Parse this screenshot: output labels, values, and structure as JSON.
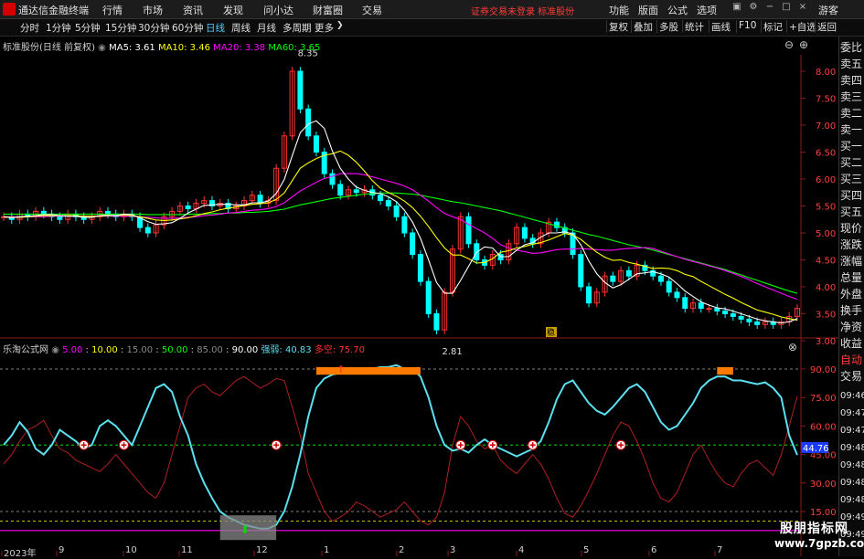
{
  "app": {
    "title": "通达信金融终端",
    "menus": [
      "行情",
      "市场",
      "资讯",
      "发现",
      "问小达",
      "财富圈",
      "交易"
    ],
    "login_warning": "证券交易未登录",
    "stock_name": "标准股份",
    "right_menus": [
      "功能",
      "版面",
      "公式",
      "选项"
    ],
    "guest": "游客"
  },
  "toolbar": {
    "periods": [
      "分时",
      "1分钟",
      "5分钟",
      "15分钟",
      "30分钟",
      "60分钟",
      "日线",
      "周线",
      "月线",
      "多周期",
      "更多"
    ],
    "active_period": "日线",
    "right_buttons": [
      "复权",
      "叠加",
      "多股",
      "统计",
      "画线",
      "F10",
      "标记",
      "+自选",
      "返回"
    ]
  },
  "kline_legend": {
    "name": "标准股份(日线 前复权)",
    "ma5": "MA5: 3.61",
    "ma10": "MA10: 3.46",
    "ma20": "MA20: 3.38",
    "ma60": "MA60: 3.65"
  },
  "price_axis": [
    "8.00",
    "7.50",
    "7.00",
    "6.50",
    "6.00",
    "5.50",
    "5.00",
    "4.50",
    "4.00",
    "3.50",
    "3.00"
  ],
  "price_annotations": {
    "high": "8.35",
    "low": "2.81",
    "marker": "稳"
  },
  "ind_legend": {
    "name": "乐淘公式网",
    "v1": "5.00",
    "v2": "10.00",
    "v3": "15.00",
    "v4": "50.00",
    "v5": "85.00",
    "v6": "90.00",
    "strong_label": "强弱:",
    "strong_val": "40.83",
    "dk_label": "多空:",
    "dk_val": "75.70"
  },
  "ind_axis": [
    "90.00",
    "75.00",
    "60.00",
    "45.00",
    "30.00",
    "15.00"
  ],
  "ind_current": "44.76",
  "x_axis": [
    "2023年",
    "9",
    "10",
    "11",
    "12",
    "1",
    "2",
    "3",
    "4",
    "5",
    "6",
    "7"
  ],
  "sidebar": {
    "items": [
      "委比",
      "卖五",
      "卖四",
      "卖三",
      "卖二",
      "卖一",
      "买一",
      "买二",
      "买三",
      "买四",
      "买五",
      "现价",
      "涨跌",
      "涨幅",
      "总量",
      "外盘",
      "换手",
      "净资",
      "收益",
      "自动",
      "交易"
    ],
    "times": [
      "09:46",
      "09:47",
      "09:47",
      "09:48",
      "09:48",
      "09:48",
      "09:48",
      "09:49",
      "09:49"
    ]
  },
  "watermark": {
    "line1": "股朋指标网",
    "line2": "www.7gpzb.com"
  },
  "colors": {
    "up": "#ff3232",
    "down": "#00ffff",
    "ma5": "#ffffff",
    "ma10": "#ffff00",
    "ma20": "#ff00ff",
    "ma60": "#00ff00",
    "strong": "#5ae0f0",
    "dk": "#b02020",
    "signal": "#ff7a00"
  },
  "series": {
    "close": [
      5.3,
      5.25,
      5.35,
      5.3,
      5.4,
      5.35,
      5.3,
      5.25,
      5.35,
      5.3,
      5.25,
      5.3,
      5.4,
      5.35,
      5.3,
      5.35,
      5.3,
      5.1,
      5.0,
      5.15,
      5.3,
      5.4,
      5.5,
      5.45,
      5.55,
      5.6,
      5.5,
      5.55,
      5.45,
      5.5,
      5.6,
      5.7,
      5.55,
      5.6,
      6.2,
      6.8,
      8.0,
      7.3,
      6.8,
      6.5,
      6.1,
      5.9,
      5.7,
      5.8,
      5.75,
      5.8,
      5.7,
      5.6,
      5.5,
      5.3,
      5.0,
      4.6,
      4.1,
      3.5,
      3.2,
      3.9,
      4.7,
      5.3,
      4.8,
      4.5,
      4.4,
      4.6,
      4.5,
      4.8,
      5.1,
      4.9,
      4.8,
      5.0,
      5.2,
      5.1,
      5.0,
      4.6,
      4.0,
      3.7,
      3.9,
      4.2,
      4.1,
      4.3,
      4.2,
      4.4,
      4.3,
      4.2,
      4.1,
      3.9,
      3.8,
      3.6,
      3.7,
      3.6,
      3.6,
      3.55,
      3.5,
      3.45,
      3.4,
      3.35,
      3.3,
      3.35,
      3.3,
      3.35,
      3.45,
      3.6
    ],
    "ma5": [
      5.3,
      5.28,
      5.3,
      5.31,
      5.32,
      5.34,
      5.34,
      5.32,
      5.31,
      5.31,
      5.29,
      5.29,
      5.32,
      5.33,
      5.32,
      5.35,
      5.34,
      5.28,
      5.21,
      5.16,
      5.17,
      5.19,
      5.27,
      5.37,
      5.44,
      5.51,
      5.52,
      5.53,
      5.53,
      5.52,
      5.52,
      5.56,
      5.56,
      5.59,
      5.73,
      5.99,
      6.43,
      6.86,
      7.02,
      7.08,
      6.94,
      6.52,
      6.2,
      6.0,
      5.85,
      5.79,
      5.75,
      5.73,
      5.67,
      5.58,
      5.42,
      5.2,
      4.9,
      4.5,
      4.08,
      3.88,
      3.88,
      4.12,
      4.38,
      4.64,
      4.74,
      4.72,
      4.56,
      4.56,
      4.68,
      4.78,
      4.82,
      4.92,
      5.0,
      5.0,
      5.02,
      4.98,
      4.78,
      4.48,
      4.24,
      4.08,
      3.98,
      4.04,
      4.14,
      4.24,
      4.26,
      4.28,
      4.24,
      4.18,
      4.06,
      3.92,
      3.82,
      3.72,
      3.66,
      3.61,
      3.59,
      3.55,
      3.5,
      3.45,
      3.4,
      3.37,
      3.35,
      3.33,
      3.35,
      3.41
    ],
    "ma10": [
      5.3,
      5.29,
      5.29,
      5.3,
      5.31,
      5.32,
      5.32,
      5.32,
      5.32,
      5.32,
      5.31,
      5.31,
      5.31,
      5.32,
      5.32,
      5.33,
      5.32,
      5.3,
      5.27,
      5.24,
      5.23,
      5.24,
      5.26,
      5.28,
      5.32,
      5.36,
      5.39,
      5.43,
      5.46,
      5.48,
      5.51,
      5.53,
      5.54,
      5.56,
      5.62,
      5.74,
      5.97,
      6.2,
      6.3,
      6.38,
      6.44,
      6.47,
      6.52,
      6.44,
      6.31,
      6.15,
      5.97,
      5.83,
      5.75,
      5.68,
      5.59,
      5.47,
      5.31,
      5.12,
      4.91,
      4.72,
      4.59,
      4.59,
      4.52,
      4.44,
      4.45,
      4.52,
      4.64,
      4.67,
      4.72,
      4.75,
      4.79,
      4.82,
      4.87,
      4.93,
      4.99,
      4.96,
      4.88,
      4.76,
      4.64,
      4.55,
      4.49,
      4.5,
      4.45,
      4.42,
      4.38,
      4.34,
      4.35,
      4.34,
      4.3,
      4.23,
      4.19,
      4.1,
      4.02,
      3.94,
      3.86,
      3.79,
      3.71,
      3.64,
      3.57,
      3.53,
      3.49,
      3.44,
      3.41,
      3.38
    ],
    "ma20": [
      5.3,
      5.3,
      5.3,
      5.3,
      5.3,
      5.3,
      5.31,
      5.31,
      5.31,
      5.31,
      5.31,
      5.31,
      5.31,
      5.31,
      5.31,
      5.31,
      5.31,
      5.3,
      5.29,
      5.28,
      5.27,
      5.27,
      5.28,
      5.29,
      5.3,
      5.32,
      5.33,
      5.35,
      5.37,
      5.38,
      5.4,
      5.42,
      5.43,
      5.45,
      5.49,
      5.56,
      5.67,
      5.78,
      5.86,
      5.94,
      6.01,
      6.05,
      6.1,
      6.1,
      6.1,
      6.08,
      6.04,
      6.0,
      5.96,
      5.92,
      5.87,
      5.8,
      5.7,
      5.59,
      5.47,
      5.36,
      5.3,
      5.25,
      5.16,
      5.08,
      5.0,
      4.9,
      4.78,
      4.72,
      4.68,
      4.65,
      4.62,
      4.63,
      4.66,
      4.69,
      4.7,
      4.7,
      4.71,
      4.7,
      4.69,
      4.68,
      4.68,
      4.7,
      4.71,
      4.72,
      4.73,
      4.71,
      4.66,
      4.61,
      4.56,
      4.51,
      4.47,
      4.43,
      4.39,
      4.35,
      4.3,
      4.25,
      4.19,
      4.13,
      4.06,
      4.0,
      3.94,
      3.88,
      3.82,
      3.77
    ],
    "ma60": [
      5.35,
      5.35,
      5.35,
      5.35,
      5.35,
      5.35,
      5.35,
      5.35,
      5.35,
      5.35,
      5.35,
      5.35,
      5.35,
      5.35,
      5.35,
      5.35,
      5.35,
      5.35,
      5.34,
      5.34,
      5.34,
      5.34,
      5.34,
      5.35,
      5.35,
      5.35,
      5.36,
      5.36,
      5.37,
      5.37,
      5.38,
      5.38,
      5.39,
      5.4,
      5.42,
      5.44,
      5.48,
      5.52,
      5.55,
      5.58,
      5.61,
      5.64,
      5.66,
      5.68,
      5.7,
      5.72,
      5.73,
      5.74,
      5.74,
      5.74,
      5.73,
      5.72,
      5.7,
      5.67,
      5.64,
      5.61,
      5.58,
      5.56,
      5.53,
      5.5,
      5.47,
      5.44,
      5.41,
      5.37,
      5.33,
      5.29,
      5.25,
      5.21,
      5.17,
      5.13,
      5.09,
      5.05,
      5.01,
      4.97,
      4.94,
      4.9,
      4.86,
      4.82,
      4.78,
      4.75,
      4.72,
      4.68,
      4.64,
      4.6,
      4.56,
      4.52,
      4.48,
      4.44,
      4.4,
      4.36,
      4.32,
      4.27,
      4.22,
      4.17,
      4.12,
      4.07,
      4.02,
      3.97,
      3.92,
      3.88
    ],
    "strong": [
      50,
      55,
      62,
      57,
      48,
      45,
      50,
      58,
      55,
      52,
      48,
      50,
      60,
      63,
      60,
      55,
      50,
      60,
      70,
      80,
      82,
      78,
      65,
      55,
      40,
      30,
      22,
      15,
      12,
      10,
      8,
      7,
      6,
      6,
      8,
      15,
      28,
      45,
      65,
      80,
      85,
      87,
      88,
      89,
      89,
      90,
      90,
      91,
      91,
      92,
      90,
      90,
      86,
      75,
      60,
      50,
      47,
      48,
      46,
      50,
      53,
      50,
      48,
      46,
      44,
      46,
      48,
      52,
      62,
      74,
      82,
      84,
      78,
      72,
      68,
      66,
      70,
      75,
      80,
      82,
      78,
      70,
      62,
      58,
      60,
      66,
      72,
      80,
      84,
      86,
      86,
      84,
      84,
      83,
      82,
      83,
      80,
      75,
      55,
      44.76
    ],
    "dk": [
      40,
      45,
      52,
      58,
      60,
      63,
      55,
      48,
      46,
      42,
      40,
      38,
      36,
      40,
      45,
      40,
      35,
      30,
      25,
      22,
      30,
      45,
      60,
      75,
      80,
      82,
      78,
      76,
      80,
      84,
      86,
      83,
      80,
      82,
      85,
      84,
      70,
      55,
      35,
      25,
      15,
      10,
      12,
      15,
      20,
      18,
      15,
      12,
      14,
      16,
      20,
      15,
      10,
      8,
      12,
      25,
      50,
      65,
      60,
      52,
      48,
      50,
      42,
      38,
      35,
      40,
      45,
      40,
      32,
      22,
      14,
      12,
      18,
      26,
      35,
      45,
      55,
      62,
      60,
      52,
      42,
      30,
      22,
      20,
      25,
      35,
      45,
      50,
      42,
      35,
      30,
      28,
      35,
      40,
      42,
      38,
      34,
      45,
      60,
      75.7
    ]
  },
  "signals": {
    "crosses_idx": [
      10,
      15,
      34,
      57,
      61,
      66,
      77
    ],
    "arrow_up_idx": 42,
    "arrow_down_idx": 30
  }
}
